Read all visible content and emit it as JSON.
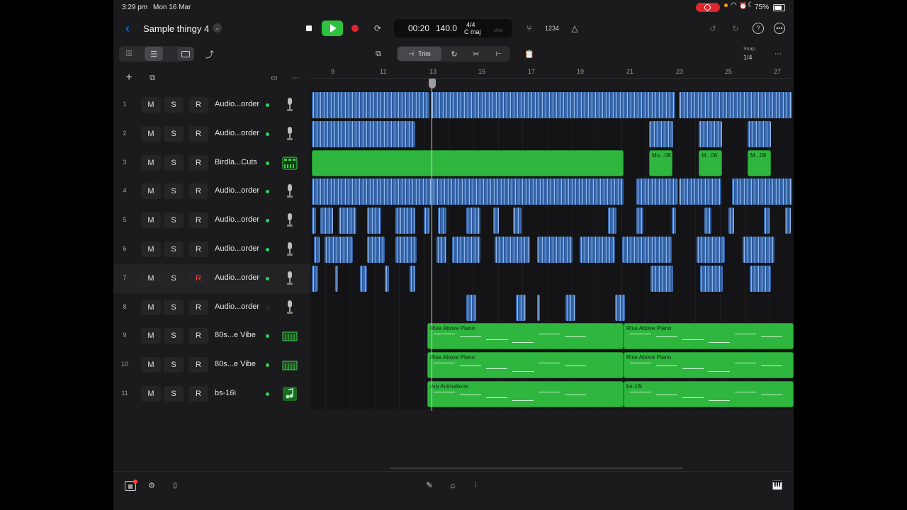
{
  "status": {
    "time": "3:29 pm",
    "date": "Mon 16 Mar",
    "battery": "75%"
  },
  "project": {
    "title": "Sample thingy 4",
    "back_icon": "chevron-left-icon",
    "menu_icon": "chevron-down-icon"
  },
  "transport": {
    "time": "00:20",
    "tempo": "140.0",
    "signature": "4/4",
    "key": "C maj",
    "midi": "MIDI",
    "count_in": "1234"
  },
  "toolbar": {
    "trim_label": "Trim",
    "snap_label": "Snap",
    "snap_value": "1/4"
  },
  "ruler": {
    "bars": [
      "9",
      "11",
      "13",
      "15",
      "17",
      "19",
      "21",
      "23",
      "25",
      "27"
    ]
  },
  "tracks": [
    {
      "num": "1",
      "m": "M",
      "s": "S",
      "r": "R",
      "name": "Audio...order",
      "icon": "microphone-icon"
    },
    {
      "num": "2",
      "m": "M",
      "s": "S",
      "r": "R",
      "name": "Audio...order",
      "icon": "microphone-icon"
    },
    {
      "num": "3",
      "m": "M",
      "s": "S",
      "r": "R",
      "name": "Birdla...Cuts",
      "icon": "drum-machine-icon"
    },
    {
      "num": "4",
      "m": "M",
      "s": "S",
      "r": "R",
      "name": "Audio...order",
      "icon": "microphone-icon"
    },
    {
      "num": "5",
      "m": "M",
      "s": "S",
      "r": "R",
      "name": "Audio...order",
      "icon": "microphone-icon"
    },
    {
      "num": "6",
      "m": "M",
      "s": "S",
      "r": "R",
      "name": "Audio...order",
      "icon": "microphone-icon"
    },
    {
      "num": "7",
      "m": "M",
      "s": "S",
      "r": "R",
      "name": "Audio...order",
      "icon": "microphone-icon"
    },
    {
      "num": "8",
      "m": "M",
      "s": "S",
      "r": "R",
      "name": "Audio...order",
      "icon": "microphone-icon"
    },
    {
      "num": "9",
      "m": "M",
      "s": "S",
      "r": "R",
      "name": "80s...e Vibe",
      "icon": "keyboard-icon"
    },
    {
      "num": "10",
      "m": "M",
      "s": "S",
      "r": "R",
      "name": "80s...e Vibe",
      "icon": "keyboard-icon"
    },
    {
      "num": "11",
      "m": "M",
      "s": "S",
      "r": "R",
      "name": "bs-16i",
      "icon": "music-note-icon"
    }
  ],
  "regions": {
    "track3_small": [
      "Mo...08",
      "M...08",
      "M...08"
    ],
    "track9": [
      "Rise Above Piano",
      "Rise Above Piano"
    ],
    "track10": [
      "Rise Above Piano",
      "Rise Above Piano"
    ],
    "track11": [
      "Arp Animations",
      "bs-16i"
    ]
  },
  "colors": {
    "region_green": "#2fb63f",
    "region_blue": "#3f6fb3",
    "play_green": "#30c13e",
    "record_red": "#e0262d",
    "record_arm_red": "#ff453a"
  }
}
